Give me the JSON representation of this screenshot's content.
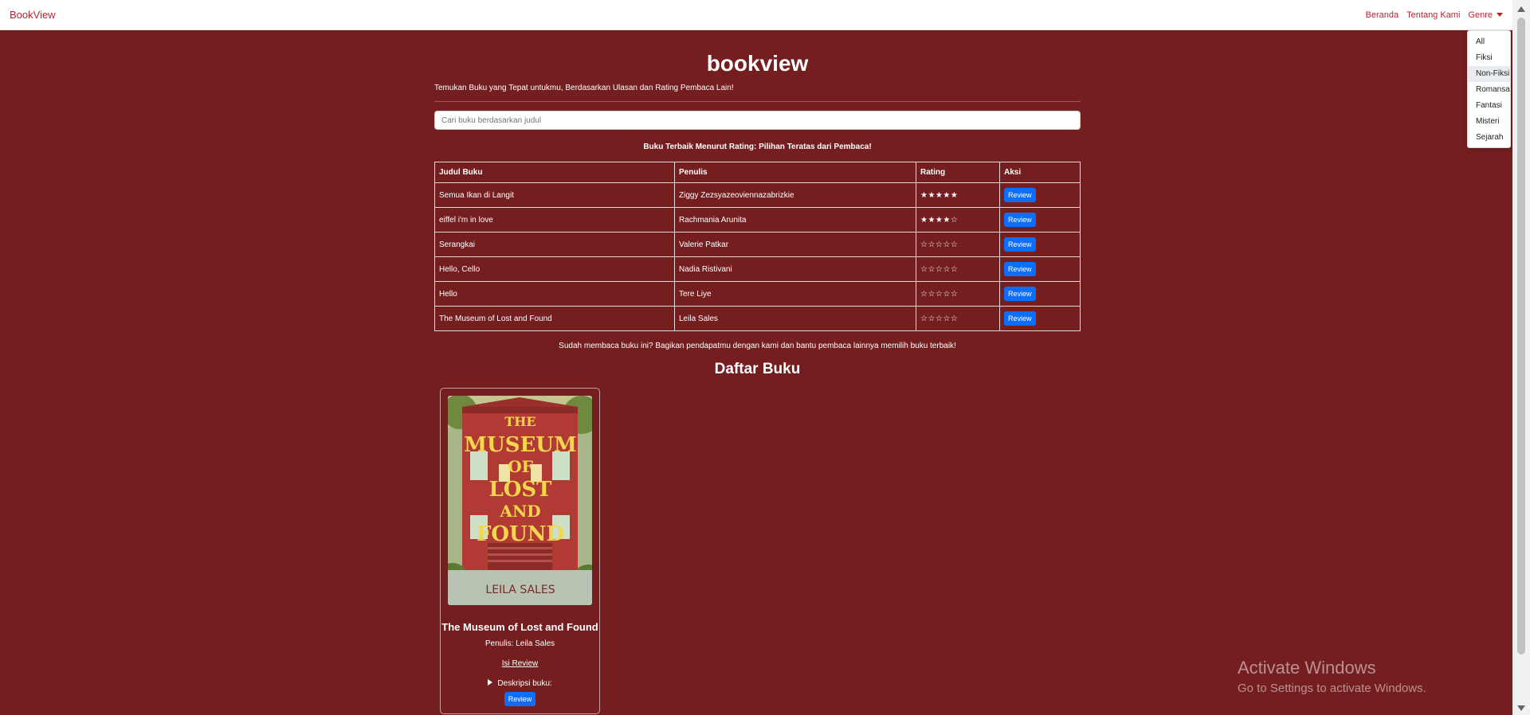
{
  "nav": {
    "brand": "BookView",
    "links": [
      "Beranda",
      "Tentang Kami",
      "Genre"
    ]
  },
  "genre_dropdown": {
    "items": [
      "All",
      "Fiksi",
      "Non-Fiksi",
      "Romansa",
      "Fantasi",
      "Misteri",
      "Sejarah"
    ],
    "active": "Non-Fiksi"
  },
  "hero": {
    "title": "bookview",
    "subtitle": "Temukan Buku yang Tepat untukmu, Berdasarkan Ulasan dan Rating Pembaca Lain!"
  },
  "search": {
    "placeholder": "Cari buku berdasarkan judul"
  },
  "ranking": {
    "caption": "Buku Terbaik Menurut Rating: Pilihan Teratas dari Pembaca!",
    "headers": [
      "Judul Buku",
      "Penulis",
      "Rating",
      "Aksi"
    ],
    "rows": [
      {
        "title": "Semua Ikan di Langit",
        "author": "Ziggy Zezsyazeoviennazabrizkie",
        "rating": "★★★★★",
        "action": "Review"
      },
      {
        "title": "eiffel i'm in love",
        "author": "Rachmania Arunita",
        "rating": "★★★★☆",
        "action": "Review"
      },
      {
        "title": "Serangkai",
        "author": "Valerie Patkar",
        "rating": "☆☆☆☆☆",
        "action": "Review"
      },
      {
        "title": "Hello, Cello",
        "author": "Nadia Ristivani",
        "rating": "☆☆☆☆☆",
        "action": "Review"
      },
      {
        "title": "Hello",
        "author": "Tere Liye",
        "rating": "☆☆☆☆☆",
        "action": "Review"
      },
      {
        "title": "The Museum of Lost and Found",
        "author": "Leila Sales",
        "rating": "☆☆☆☆☆",
        "action": "Review"
      }
    ],
    "cta": "Sudah membaca buku ini? Bagikan pendapatmu dengan kami dan bantu pembaca lainnya memilih buku terbaik!"
  },
  "book_list": {
    "heading": "Daftar Buku",
    "cards": [
      {
        "cover_lines": [
          "THE",
          "MUSEUM",
          "OF",
          "LOST",
          "AND",
          "FOUND"
        ],
        "cover_author": "LEILA SALES",
        "title": "The Museum of Lost and Found",
        "author_line": "Penulis: Leila Sales",
        "review_link": "Isi Review",
        "desc_label": "Deskripsi buku:",
        "button": "Review"
      }
    ]
  },
  "watermark": {
    "line1": "Activate Windows",
    "line2": "Go to Settings to activate Windows."
  },
  "colors": {
    "background": "#741e1f",
    "brand_red": "#c41e2b",
    "button_blue": "#0d6efd"
  }
}
